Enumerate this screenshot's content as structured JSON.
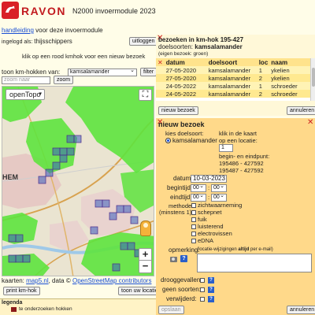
{
  "header": {
    "app_name": "RAVON",
    "title": "N2000 invoermodule 2023",
    "manual_link": "handleiding",
    "manual_suffix": " voor deze invoermodule",
    "logged_in_label": "ingelogd als:",
    "user": "thijsschippers",
    "logout_button": "uitloggen"
  },
  "left": {
    "instruction": "klik op een rood kmhok voor een nieuw bezoek",
    "show_hokken_label": "toon km-hokken van:",
    "species_select": "kamsalamander",
    "filter_button": "filter",
    "zoom_placeholder": "zoom naar",
    "zoom_value": "",
    "zoom_button": "zoom",
    "map_layer": "openTopo",
    "fullscreen_icon": "⛶",
    "zoom_in": "+",
    "zoom_out": "−",
    "city_label": "HEM",
    "attribution_prefix": "kaarten: ",
    "attribution_link1": "map5.nl",
    "attribution_mid": ", data © ",
    "attribution_link2": "OpenStreetMap contributors",
    "print_button": "print km-hok",
    "location_button": "toon uw locatie",
    "legend_title": "legenda",
    "legend_item": "te onderzoeken hokken",
    "legend_color": "#8b1a1a"
  },
  "visits": {
    "title_prefix": "bezoeken in km-hok ",
    "kmhok": "195-427",
    "species_label": "doelsoorten: ",
    "species": "kamsalamander",
    "own_visit_note": "(eigen bezoek: groen)",
    "columns": [
      "datum",
      "doelsoort",
      "loc",
      "naam"
    ],
    "rows": [
      {
        "datum": "27-05-2020",
        "doelsoort": "kamsalamander",
        "loc": "1",
        "naam": "ykelien"
      },
      {
        "datum": "27-05-2020",
        "doelsoort": "kamsalamander",
        "loc": "2",
        "naam": "ykelien"
      },
      {
        "datum": "24-05-2022",
        "doelsoort": "kamsalamander",
        "loc": "1",
        "naam": "schroeder"
      },
      {
        "datum": "24-05-2022",
        "doelsoort": "kamsalamander",
        "loc": "2",
        "naam": "schroeder"
      }
    ],
    "new_visit_button": "nieuw bezoek",
    "cancel_button": "annuleren"
  },
  "new_visit": {
    "title": "nieuw bezoek",
    "choose_species_label": "kies doelsoort:",
    "species_option": "kamsalamander",
    "map_click_label1": "klik in de kaart",
    "map_click_label2": "op een locatie:",
    "location_value": "1",
    "start_end_label1": "begin- en eindpunt:",
    "coord1": "195486 - 427592",
    "coord2": "195487 - 427592",
    "date_label": "datum:",
    "date_value": "10-03-2023",
    "start_label": "begintijd:",
    "start_hour": "00",
    "start_min": "00",
    "end_label": "eindtijd:",
    "end_hour": "00",
    "end_min": "00",
    "method_label1": "methode:",
    "method_label2": "(minstens 1)",
    "methods": [
      "zichtwaarneming",
      "schepnet",
      "fuik",
      "luisterend",
      "electrovissen",
      "eDNA"
    ],
    "remark_label": "opmerking:",
    "remark_hint_prefix": "(locatie-wijzigingen ",
    "remark_hint_bold": "altijd",
    "remark_hint_suffix": " per e-mail)",
    "remark_value": "",
    "help_icon": "?",
    "dry_label": "drooggevallen:",
    "no_species_label": "geen soorten:",
    "removed_label": "verwijderd:",
    "save_button": "opslaan",
    "cancel_button": "annuleren"
  },
  "colors": {
    "close_red": "#cc2222",
    "panel_header": "#ffd98a",
    "map_green": "#5ee33e"
  }
}
